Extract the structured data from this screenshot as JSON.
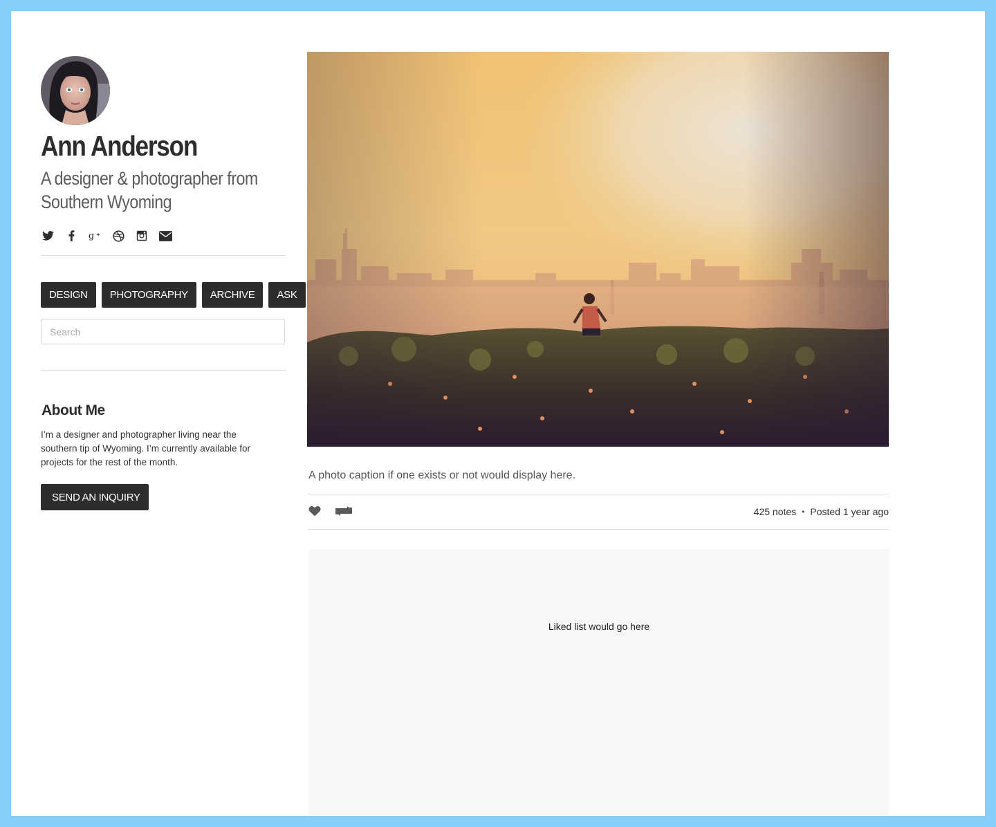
{
  "profile": {
    "name": "Ann Anderson",
    "tagline_line1": "A designer & photographer from",
    "tagline_line2": "Southern Wyoming"
  },
  "social_icons": [
    "twitter-icon",
    "facebook-icon",
    "google-plus-icon",
    "dribbble-icon",
    "instagram-icon",
    "email-icon"
  ],
  "nav": {
    "items": [
      {
        "label": "DESIGN"
      },
      {
        "label": "PHOTOGRAPHY"
      },
      {
        "label": "ARCHIVE"
      },
      {
        "label": "ASK"
      }
    ]
  },
  "search": {
    "placeholder": "Search",
    "value": ""
  },
  "about": {
    "title": "About Me",
    "text": "I’m a designer and photographer living near the southern tip of Wyoming. I’m currently available for projects for the rest of the month.",
    "button_label": "SEND AN INQUIRY"
  },
  "post": {
    "caption": "A photo caption if one exists or not would display here.",
    "notes": "425 notes",
    "separator": "•",
    "posted": "Posted 1 year ago",
    "like_icon": "heart-icon",
    "reblog_icon": "reblog-icon"
  },
  "liked": {
    "text": "Liked list would go here"
  },
  "colors": {
    "frame": "#85cffd",
    "button_bg": "#2d2d2d",
    "liked_bg": "#f7f7f7"
  }
}
